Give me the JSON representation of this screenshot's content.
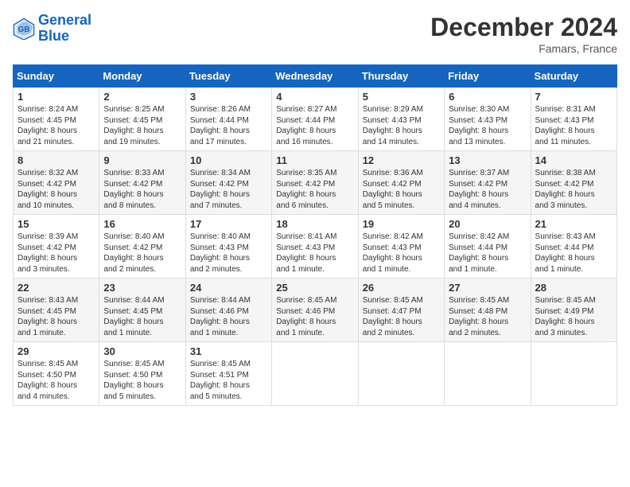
{
  "logo": {
    "line1": "General",
    "line2": "Blue"
  },
  "title": "December 2024",
  "location": "Famars, France",
  "days_header": [
    "Sunday",
    "Monday",
    "Tuesday",
    "Wednesday",
    "Thursday",
    "Friday",
    "Saturday"
  ],
  "weeks": [
    [
      {
        "day": "1",
        "info": "Sunrise: 8:24 AM\nSunset: 4:45 PM\nDaylight: 8 hours\nand 21 minutes."
      },
      {
        "day": "2",
        "info": "Sunrise: 8:25 AM\nSunset: 4:45 PM\nDaylight: 8 hours\nand 19 minutes."
      },
      {
        "day": "3",
        "info": "Sunrise: 8:26 AM\nSunset: 4:44 PM\nDaylight: 8 hours\nand 17 minutes."
      },
      {
        "day": "4",
        "info": "Sunrise: 8:27 AM\nSunset: 4:44 PM\nDaylight: 8 hours\nand 16 minutes."
      },
      {
        "day": "5",
        "info": "Sunrise: 8:29 AM\nSunset: 4:43 PM\nDaylight: 8 hours\nand 14 minutes."
      },
      {
        "day": "6",
        "info": "Sunrise: 8:30 AM\nSunset: 4:43 PM\nDaylight: 8 hours\nand 13 minutes."
      },
      {
        "day": "7",
        "info": "Sunrise: 8:31 AM\nSunset: 4:43 PM\nDaylight: 8 hours\nand 11 minutes."
      }
    ],
    [
      {
        "day": "8",
        "info": "Sunrise: 8:32 AM\nSunset: 4:42 PM\nDaylight: 8 hours\nand 10 minutes."
      },
      {
        "day": "9",
        "info": "Sunrise: 8:33 AM\nSunset: 4:42 PM\nDaylight: 8 hours\nand 8 minutes."
      },
      {
        "day": "10",
        "info": "Sunrise: 8:34 AM\nSunset: 4:42 PM\nDaylight: 8 hours\nand 7 minutes."
      },
      {
        "day": "11",
        "info": "Sunrise: 8:35 AM\nSunset: 4:42 PM\nDaylight: 8 hours\nand 6 minutes."
      },
      {
        "day": "12",
        "info": "Sunrise: 8:36 AM\nSunset: 4:42 PM\nDaylight: 8 hours\nand 5 minutes."
      },
      {
        "day": "13",
        "info": "Sunrise: 8:37 AM\nSunset: 4:42 PM\nDaylight: 8 hours\nand 4 minutes."
      },
      {
        "day": "14",
        "info": "Sunrise: 8:38 AM\nSunset: 4:42 PM\nDaylight: 8 hours\nand 3 minutes."
      }
    ],
    [
      {
        "day": "15",
        "info": "Sunrise: 8:39 AM\nSunset: 4:42 PM\nDaylight: 8 hours\nand 3 minutes."
      },
      {
        "day": "16",
        "info": "Sunrise: 8:40 AM\nSunset: 4:42 PM\nDaylight: 8 hours\nand 2 minutes."
      },
      {
        "day": "17",
        "info": "Sunrise: 8:40 AM\nSunset: 4:43 PM\nDaylight: 8 hours\nand 2 minutes."
      },
      {
        "day": "18",
        "info": "Sunrise: 8:41 AM\nSunset: 4:43 PM\nDaylight: 8 hours\nand 1 minute."
      },
      {
        "day": "19",
        "info": "Sunrise: 8:42 AM\nSunset: 4:43 PM\nDaylight: 8 hours\nand 1 minute."
      },
      {
        "day": "20",
        "info": "Sunrise: 8:42 AM\nSunset: 4:44 PM\nDaylight: 8 hours\nand 1 minute."
      },
      {
        "day": "21",
        "info": "Sunrise: 8:43 AM\nSunset: 4:44 PM\nDaylight: 8 hours\nand 1 minute."
      }
    ],
    [
      {
        "day": "22",
        "info": "Sunrise: 8:43 AM\nSunset: 4:45 PM\nDaylight: 8 hours\nand 1 minute."
      },
      {
        "day": "23",
        "info": "Sunrise: 8:44 AM\nSunset: 4:45 PM\nDaylight: 8 hours\nand 1 minute."
      },
      {
        "day": "24",
        "info": "Sunrise: 8:44 AM\nSunset: 4:46 PM\nDaylight: 8 hours\nand 1 minute."
      },
      {
        "day": "25",
        "info": "Sunrise: 8:45 AM\nSunset: 4:46 PM\nDaylight: 8 hours\nand 1 minute."
      },
      {
        "day": "26",
        "info": "Sunrise: 8:45 AM\nSunset: 4:47 PM\nDaylight: 8 hours\nand 2 minutes."
      },
      {
        "day": "27",
        "info": "Sunrise: 8:45 AM\nSunset: 4:48 PM\nDaylight: 8 hours\nand 2 minutes."
      },
      {
        "day": "28",
        "info": "Sunrise: 8:45 AM\nSunset: 4:49 PM\nDaylight: 8 hours\nand 3 minutes."
      }
    ],
    [
      {
        "day": "29",
        "info": "Sunrise: 8:45 AM\nSunset: 4:50 PM\nDaylight: 8 hours\nand 4 minutes."
      },
      {
        "day": "30",
        "info": "Sunrise: 8:45 AM\nSunset: 4:50 PM\nDaylight: 8 hours\nand 5 minutes."
      },
      {
        "day": "31",
        "info": "Sunrise: 8:45 AM\nSunset: 4:51 PM\nDaylight: 8 hours\nand 5 minutes."
      },
      null,
      null,
      null,
      null
    ]
  ]
}
